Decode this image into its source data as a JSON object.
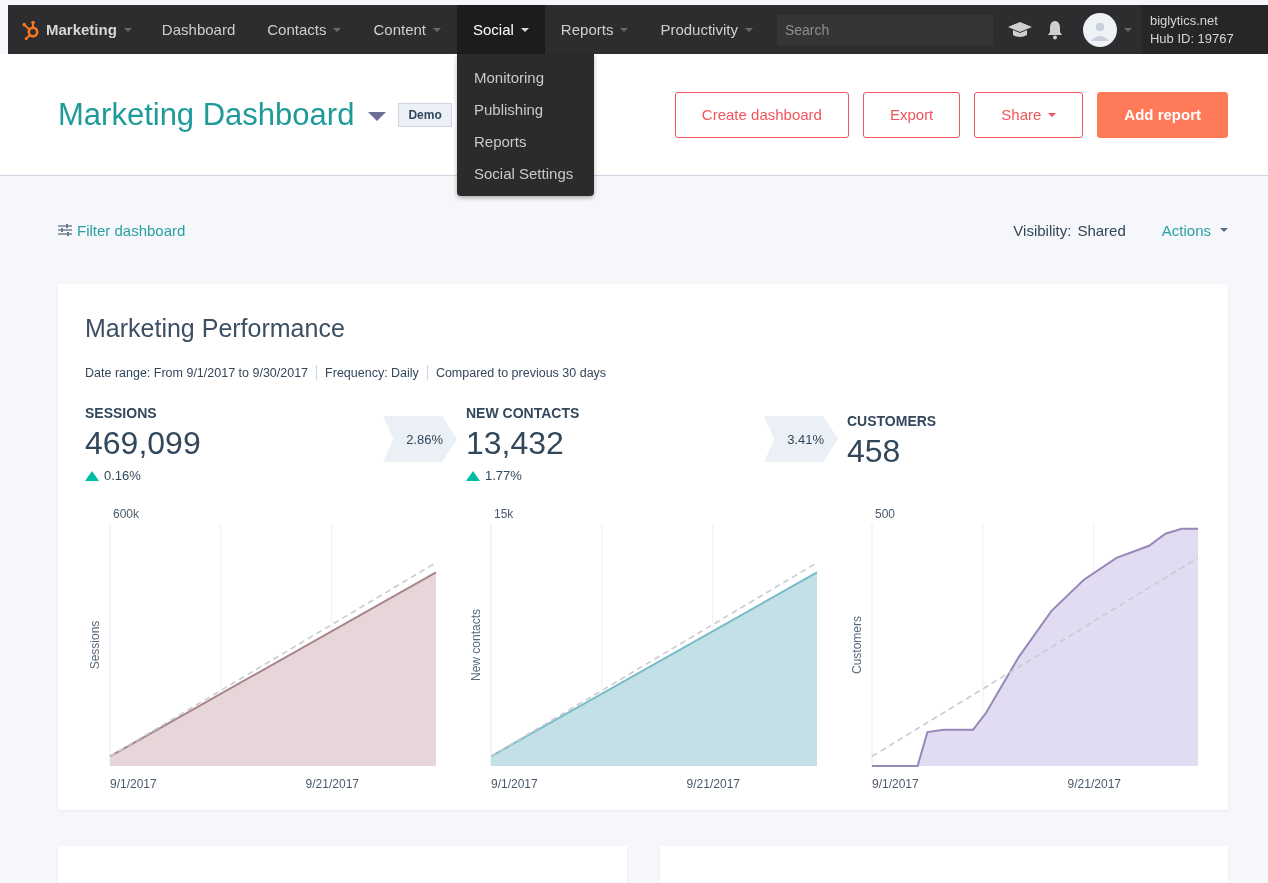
{
  "nav": {
    "brand": "Marketing",
    "items": [
      {
        "label": "Dashboard",
        "dropdown": false,
        "selected": false
      },
      {
        "label": "Contacts",
        "dropdown": true,
        "selected": false
      },
      {
        "label": "Content",
        "dropdown": true,
        "selected": false
      },
      {
        "label": "Social",
        "dropdown": true,
        "selected": true
      },
      {
        "label": "Reports",
        "dropdown": true,
        "selected": false
      },
      {
        "label": "Productivity",
        "dropdown": true,
        "selected": false
      }
    ],
    "search": {
      "placeholder": "Search"
    },
    "account": {
      "name": "biglytics.net",
      "hub": "Hub ID: 19767"
    }
  },
  "social_menu": [
    "Monitoring",
    "Publishing",
    "Reports",
    "Social Settings"
  ],
  "header": {
    "title": "Marketing Dashboard",
    "badge": "Demo",
    "buttons": [
      {
        "label": "Create dashboard",
        "kind": "outline",
        "caret": false
      },
      {
        "label": "Export",
        "kind": "outline",
        "caret": false
      },
      {
        "label": "Share",
        "kind": "outline",
        "caret": true
      },
      {
        "label": "Add report",
        "kind": "primary",
        "caret": false
      }
    ]
  },
  "toolbar": {
    "filter": "Filter dashboard",
    "visibility_label": "Visibility:",
    "visibility_value": "Shared",
    "actions": "Actions"
  },
  "report": {
    "title": "Marketing Performance",
    "meta": [
      "Date range: From 9/1/2017 to 9/30/2017",
      "Frequency: Daily",
      "Compared to previous 30 days"
    ],
    "metrics": [
      {
        "label": "SESSIONS",
        "value": "469,099",
        "change": "0.16%",
        "conversion": "2.86%",
        "kind": "straight",
        "color": "#e6d6d9",
        "ytick": "600k",
        "ylabel": "Sessions",
        "xlabels": [
          "9/1/2017",
          "9/21/2017"
        ]
      },
      {
        "label": "NEW CONTACTS",
        "value": "13,432",
        "change": "1.77%",
        "conversion": "3.41%",
        "kind": "straight",
        "color": "#c2e0e6",
        "ytick": "15k",
        "ylabel": "New contacts",
        "xlabels": [
          "9/1/2017",
          "9/21/2017"
        ]
      },
      {
        "label": "CUSTOMERS",
        "value": "458",
        "kind": "s-curve",
        "color": "#e2dcf2",
        "ytick": "500",
        "ylabel": "Customers",
        "xlabels": [
          "9/1/2017",
          "9/21/2017"
        ]
      }
    ]
  }
}
